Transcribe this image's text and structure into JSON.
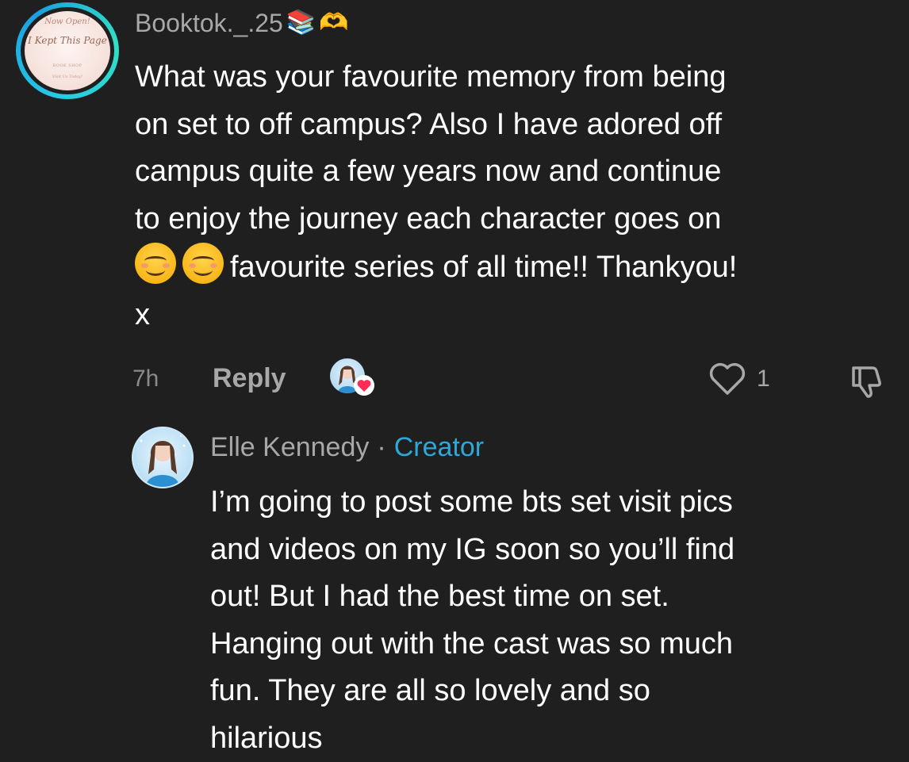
{
  "comment": {
    "avatar": {
      "logo_top": "Now Open!",
      "logo_main": "I Kept This Page",
      "logo_sub": "BOOK SHOP",
      "logo_bottom": "Visit Us Today!"
    },
    "username": "Booktok._.25",
    "username_emojis": [
      "📚",
      "🫶"
    ],
    "text_part1": "What was your favourite memory from being\non set to off campus? Also I have adored off\ncampus quite a few years now and continue\nto enjoy the journey each character goes on\n",
    "smiley_emojis": [
      "😊",
      "😊"
    ],
    "text_part2": "favourite series of all time!! Thankyou!\nx",
    "time": "7h",
    "reply_label": "Reply",
    "like_count": "1",
    "liked_by_creator": true,
    "icons": {
      "like": "heart-outline-icon",
      "dislike": "thumbs-down-icon",
      "creator_heart": "heart-badge-icon"
    }
  },
  "reply": {
    "author": "Elle Kennedy",
    "separator": "·",
    "badge": "Creator",
    "text": "I’m going to post some bts set visit pics\nand videos on my IG soon so you’ll find\nout! But I had the best time on set.\nHanging out with the cast was so much\nfun. They are all so lovely and so\nhilarious"
  },
  "colors": {
    "background": "#1f1f1f",
    "primary_text": "#ffffff",
    "secondary_text": "#a8a8a8",
    "creator_badge": "#2fa7d8",
    "avatar_ring": "#27c7e6",
    "heart_badge": "#fe2c55"
  }
}
